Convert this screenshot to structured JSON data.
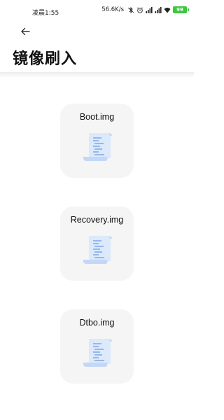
{
  "status_bar": {
    "time": "凌晨1:55",
    "network_speed": "56.6K/s",
    "battery_level": "99",
    "icons": [
      "bluetooth-muted-icon",
      "alarm-icon",
      "signal-icon",
      "signal-icon",
      "wifi-icon",
      "battery-icon"
    ]
  },
  "header": {
    "back_icon": "arrow-left-icon",
    "title": "镜像刷入"
  },
  "cards": [
    {
      "label": "Boot.img",
      "icon": "scroll-document-icon"
    },
    {
      "label": "Recovery.img",
      "icon": "scroll-document-icon"
    },
    {
      "label": "Dtbo.img",
      "icon": "scroll-document-icon"
    }
  ],
  "colors": {
    "card_background": "#f5f5f5",
    "icon_light_blue": "#dce9fb",
    "icon_mid_blue": "#b9d3f6",
    "icon_line_blue": "#6f9ee0",
    "battery_green": "#3cc83c"
  }
}
